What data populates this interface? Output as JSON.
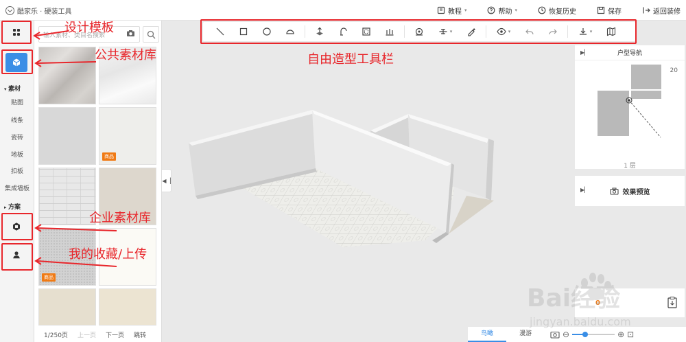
{
  "app": {
    "title": "酷家乐 · 硬装工具"
  },
  "topmenu": [
    {
      "label": "教程",
      "icon": "book-icon",
      "caret": "▾"
    },
    {
      "label": "帮助",
      "icon": "help-icon",
      "caret": "▾"
    },
    {
      "label": "恢复历史",
      "icon": "clock-icon"
    },
    {
      "label": "保存",
      "icon": "save-icon"
    },
    {
      "label": "返回装修",
      "icon": "exit-icon"
    }
  ],
  "sidebar": {
    "categories_header": "素材",
    "categories": [
      "贴图",
      "线条",
      "瓷砖",
      "地板",
      "扣板",
      "集成墙板"
    ],
    "scheme_header": "方案"
  },
  "panel": {
    "search_placeholder": "输入素材、类目名搜索",
    "tiles": [
      {
        "pattern": "marble1",
        "tag": ""
      },
      {
        "pattern": "marble2",
        "tag": ""
      },
      {
        "pattern": "grey1",
        "tag": ""
      },
      {
        "pattern": "white1",
        "tag": "商品"
      },
      {
        "pattern": "brick",
        "tag": ""
      },
      {
        "pattern": "beige1",
        "tag": ""
      },
      {
        "pattern": "dots",
        "tag": "商品"
      },
      {
        "pattern": "cream1",
        "tag": ""
      },
      {
        "pattern": "beige2",
        "tag": ""
      },
      {
        "pattern": "beige3",
        "tag": ""
      }
    ],
    "pager": {
      "page": "1/250页",
      "prev": "上一页",
      "next": "下一页",
      "jump": "跳转"
    }
  },
  "toolbar": {
    "tools": [
      "line-tool-icon",
      "rect-tool-icon",
      "circle-tool-icon",
      "arc-tool-icon",
      "push-pull-icon",
      "sweep-icon",
      "offset-icon",
      "array-icon",
      "rotate-icon",
      "align-icon",
      "paint-icon",
      "view-icon",
      "undo-icon",
      "redo-icon",
      "download-icon",
      "map-icon"
    ]
  },
  "right": {
    "nav_title": "户型导航",
    "nav_number": "20",
    "floor": "1 层",
    "preview_label": "效果预览",
    "bottom_value": "0"
  },
  "bottom": {
    "tabs": [
      {
        "label": "鸟瞰",
        "active": true
      },
      {
        "label": "漫游",
        "active": false
      }
    ]
  },
  "annotations": {
    "design_template": "设计模板",
    "public_library": "公共素材库",
    "toolbar": "自由造型工具栏",
    "enterprise_library": "企业素材库",
    "my_favorites": "我的收藏/上传"
  },
  "watermark": {
    "text": "Bai经验",
    "url": "jingyan.baidu.com"
  },
  "colors": {
    "accent": "#3a8ee6",
    "annotation": "#e8262b",
    "tag": "#f07a14"
  }
}
